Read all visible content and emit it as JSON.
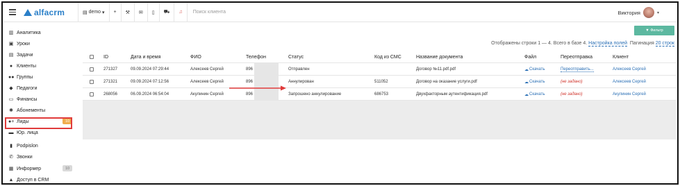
{
  "topbar": {
    "logo_text": "alfacrm",
    "branch": "demo",
    "plus": "+",
    "search_placeholder": "Поиск клиента",
    "user_name": "Виктория"
  },
  "sidebar": {
    "items": [
      {
        "label": "Аналитика",
        "icon": "chart-icon",
        "glyph": "▥"
      },
      {
        "label": "Уроки",
        "icon": "calendar-icon",
        "glyph": "▣"
      },
      {
        "label": "Задачи",
        "icon": "clipboard-icon",
        "glyph": "▤"
      },
      {
        "label": "Клиенты",
        "icon": "user-icon",
        "glyph": "●"
      },
      {
        "label": "Группы",
        "icon": "users-icon",
        "glyph": "●●"
      },
      {
        "label": "Педагоги",
        "icon": "graduation-cap-icon",
        "glyph": "◆"
      },
      {
        "label": "Финансы",
        "icon": "money-icon",
        "glyph": "▭"
      },
      {
        "label": "Абонементы",
        "icon": "gear-icon",
        "glyph": "✱"
      },
      {
        "label": "Лиды",
        "icon": "user-plus-icon",
        "glyph": "●+",
        "badge": "10",
        "badge_color": "#f0ad4e"
      },
      {
        "label": "Юр. лица",
        "icon": "briefcase-icon",
        "glyph": "▬"
      },
      {
        "label": "Podpislon",
        "icon": "file-icon",
        "glyph": "▮"
      },
      {
        "label": "Звонки",
        "icon": "phone-icon",
        "glyph": "✆"
      },
      {
        "label": "Информер",
        "icon": "inbox-icon",
        "glyph": "▦",
        "badge": "10",
        "badge_color": "#d9d9d9"
      },
      {
        "label": "Доступ в CRM",
        "icon": "lock-icon",
        "glyph": "▲"
      }
    ]
  },
  "main": {
    "filter_button": "Фильтр",
    "pager_text": "Отображены строки 1 — 4. Всего в базе 4.",
    "pager_settings": "Настройка полей",
    "pager_label": "Пагинация",
    "pager_value": "20 строк"
  },
  "table": {
    "columns": [
      "ID",
      "Дата и время",
      "ФИО",
      "Телефон",
      "Статус",
      "Код из СМС",
      "Название документа",
      "Файл",
      "Переотправка",
      "Клиент"
    ],
    "rows": [
      {
        "id": "271327",
        "datetime": "09.09.2024 07:29:44",
        "fio": "Алексеев Сергей",
        "phone": "896",
        "status": "Отправлен",
        "sms": "",
        "document": "Договор №11.pdf.pdf",
        "file": "Скачать",
        "resend": "Переотправить...",
        "resend_type": "link",
        "client": "Алексеев Сергей"
      },
      {
        "id": "271321",
        "datetime": "09.09.2024 07:12:56",
        "fio": "Алексеев Сергей",
        "phone": "896",
        "status": "Аннулирован",
        "sms": "511052",
        "document": "Договор на оказание услуги.pdf",
        "file": "Скачать",
        "resend": "(не задано)",
        "resend_type": "none",
        "client": "Алексеев Сергей"
      },
      {
        "id": "268056",
        "datetime": "06.09.2024 06:54:04",
        "fio": "Акулинин Сергей",
        "phone": "896",
        "status": "Запрошено аннулирование",
        "sms": "686753",
        "document": "Двухфакторным аутентификация.pdf",
        "file": "Скачать",
        "resend": "(не задано)",
        "resend_type": "none",
        "client": "Акулинин Сергей"
      }
    ]
  },
  "colors": {
    "accent": "#2a7fc8",
    "filter": "#5cb8a0",
    "highlight": "#e03b3b"
  }
}
